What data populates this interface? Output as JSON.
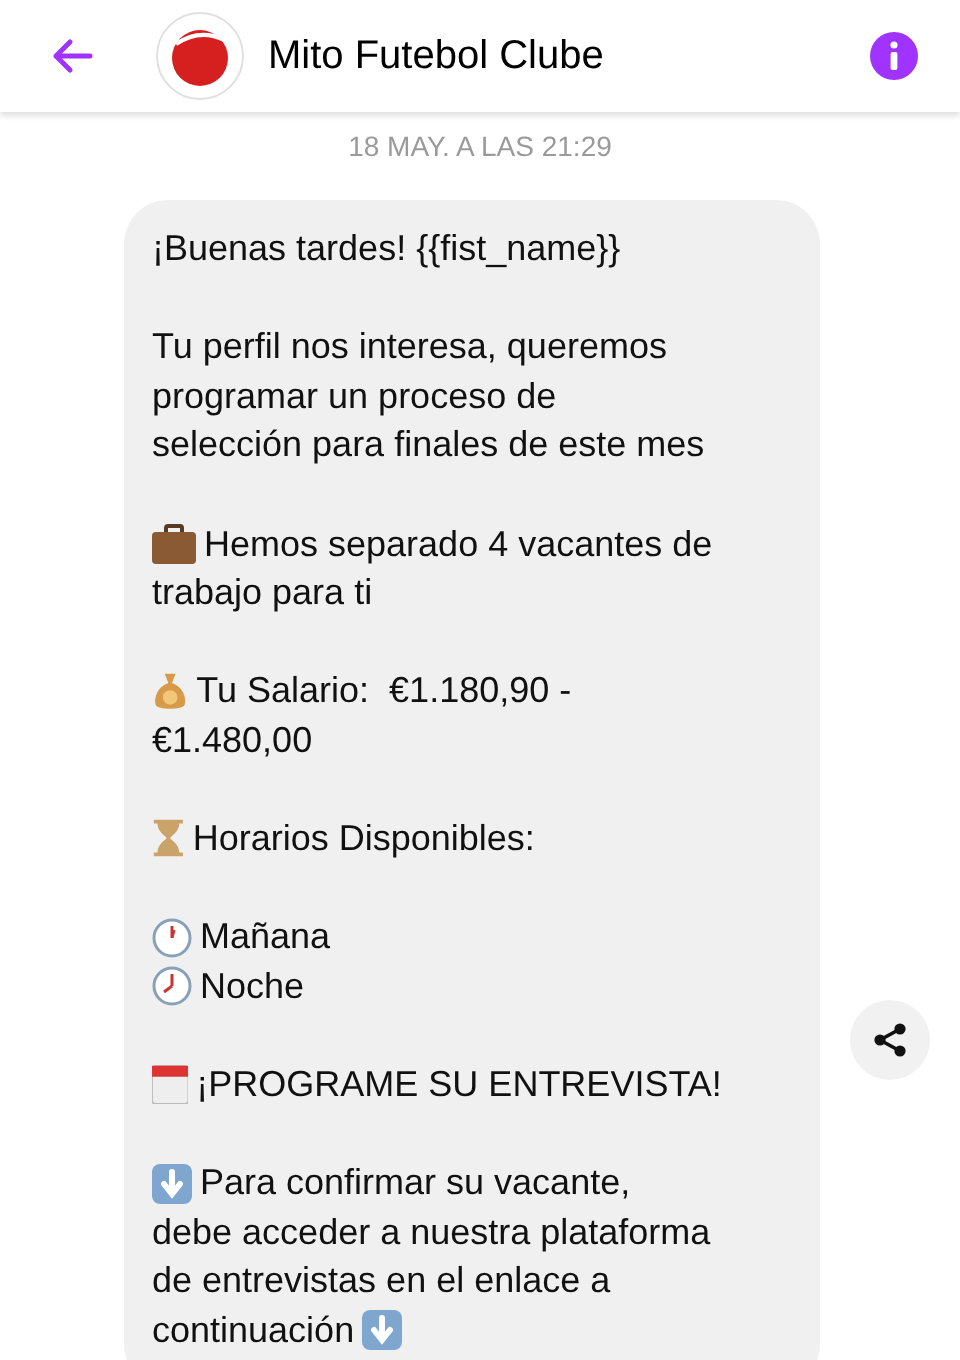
{
  "header": {
    "title": "Mito Futebol Clube"
  },
  "timestamp": "18 MAY. A LAS 21:29",
  "message": {
    "paragraphs": [
      [
        {
          "kind": "plain",
          "text": "¡Buenas tardes! {{fist_name}}"
        }
      ],
      [
        {
          "kind": "plain",
          "text": "Tu perfil nos interesa, queremos\nprogramar un proceso de\nselección para finales de este mes"
        }
      ],
      [
        {
          "kind": "briefcase",
          "text": "Hemos separado 4 vacantes de\ntrabajo para ti"
        }
      ],
      [
        {
          "kind": "money",
          "text": "Tu Salario:  €1.180,90 -\n€1.480,00"
        }
      ],
      [
        {
          "kind": "hourglass",
          "text": "Horarios Disponibles:"
        }
      ],
      [
        {
          "kind": "clock-one",
          "text": "Mañana"
        },
        {
          "kind": "clock-seven",
          "text": "Noche"
        }
      ],
      [
        {
          "kind": "calendar",
          "text": "¡PROGRAME SU ENTREVISTA!"
        }
      ],
      [
        {
          "kind": "arrows",
          "text": "Para confirmar su vacante,\ndebe acceder a nuestra plataforma\nde entrevistas en el enlace a\ncontinuación"
        }
      ]
    ]
  }
}
